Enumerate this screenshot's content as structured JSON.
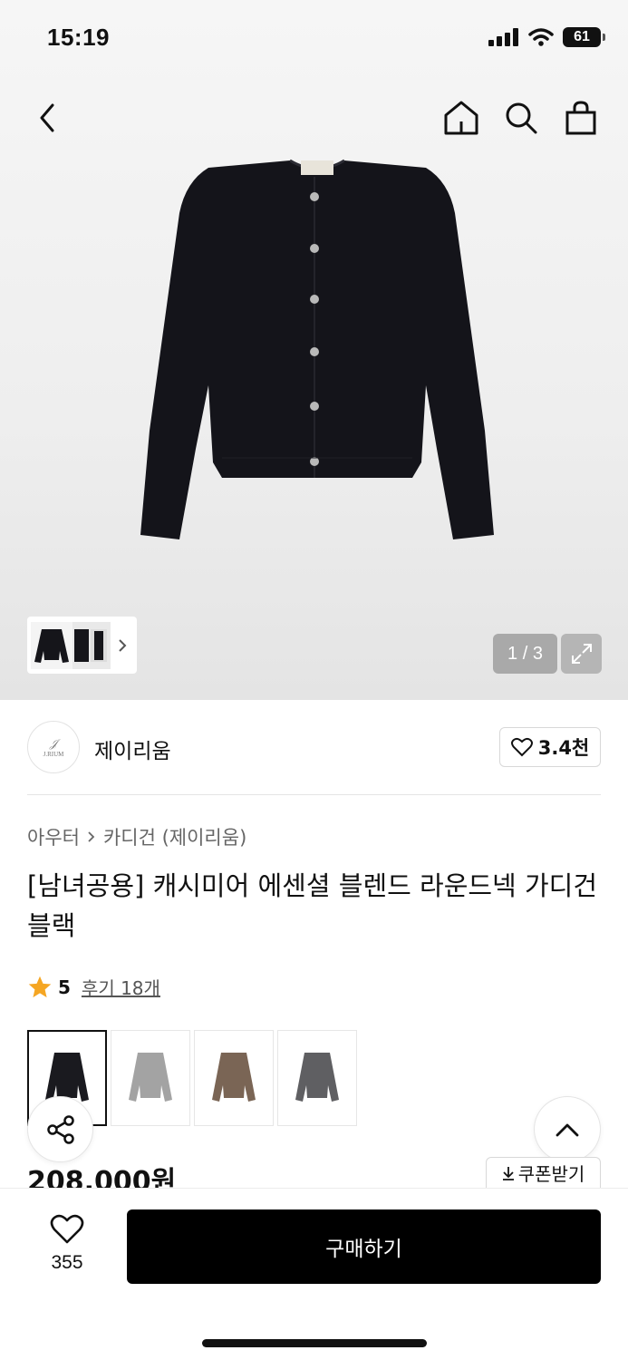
{
  "status_bar": {
    "time": "15:19",
    "battery": "61"
  },
  "icons": {
    "back": "chevron-left-icon",
    "home": "home-icon",
    "search": "search-icon",
    "bag": "shopping-bag-icon",
    "share": "share-icon",
    "scroll_top": "chevron-up-icon",
    "heart": "heart-icon",
    "star": "star-icon",
    "expand": "expand-icon"
  },
  "gallery": {
    "counter": "1 / 3"
  },
  "brand": {
    "logo_text": "J.RIUM",
    "name": "제이리움",
    "likes": "3.4천"
  },
  "breadcrumb": {
    "category": "아우터",
    "sub": "카디건 (제이리움)"
  },
  "product": {
    "title": "[남녀공용] 캐시미어 에센셜 블렌드 라운드넥 가디건 블랙",
    "rating": "5",
    "reviews": "후기 18개",
    "price": "208,000원"
  },
  "colors": {
    "swatches": [
      "#1a1a1f",
      "#a3a3a3",
      "#7a6555",
      "#5f5f62"
    ],
    "star": "#f5a623"
  },
  "coupon": {
    "label": "쿠폰받기"
  },
  "bottom": {
    "wish_count": "355",
    "buy_label": "구매하기"
  }
}
